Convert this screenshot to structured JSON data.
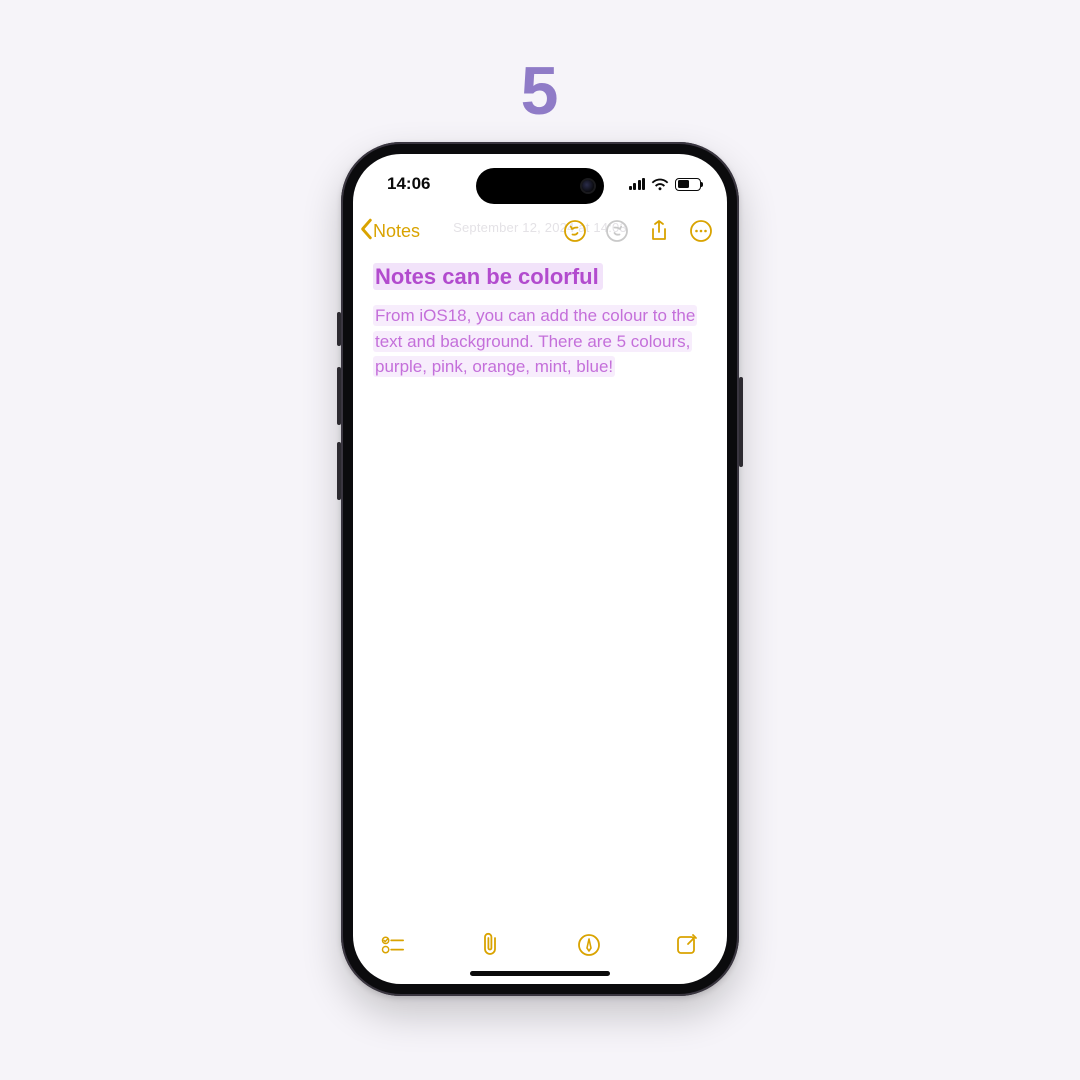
{
  "slide": {
    "number": "5"
  },
  "status": {
    "time": "14:06"
  },
  "nav": {
    "back_label": "Notes",
    "timestamp_ghost": "September 12, 2024 at 14:03"
  },
  "note": {
    "title": "Notes can be colorful",
    "body": "From iOS18, you can add the colour to the text and background. There are 5 colours, purple, pink, orange, mint, blue!"
  },
  "colors": {
    "accent": "#d9a300",
    "title_text": "#b24bce",
    "body_text": "#c46fda",
    "highlight_bg": "#f2e3fa"
  }
}
